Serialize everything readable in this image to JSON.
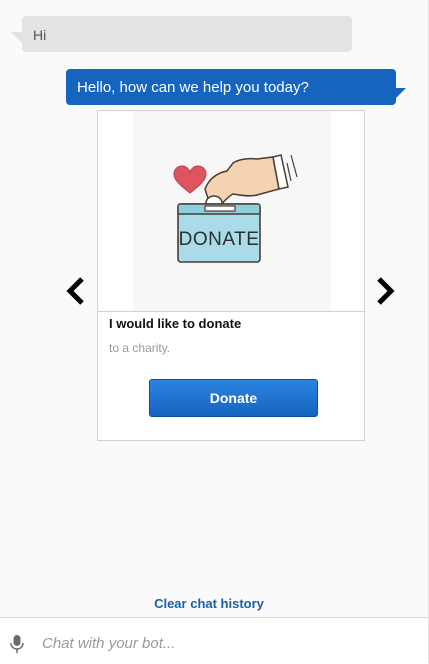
{
  "messages": {
    "user": "Hi",
    "bot": "Hello, how can we help you today?"
  },
  "card": {
    "image_text": "DONATE",
    "title": "I would like to donate",
    "subtitle": "to a charity.",
    "button_label": "Donate"
  },
  "clear_history": "Clear chat history",
  "input": {
    "placeholder": "Chat with your bot...",
    "value": ""
  },
  "colors": {
    "bot_bubble": "#1565c0",
    "user_bubble": "#e3e3e3",
    "link": "#1a5fa8"
  },
  "icons": {
    "left": "chevron-left-icon",
    "right": "chevron-right-icon",
    "mic": "microphone-icon"
  }
}
